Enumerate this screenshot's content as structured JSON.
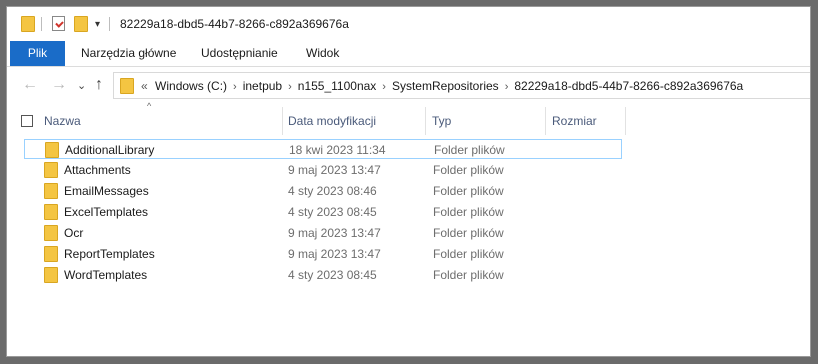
{
  "titlebar": {
    "title": "82229a18-dbd5-44b7-8266-c892a369676a",
    "icons": [
      "folder-icon",
      "properties-check-icon",
      "new-folder-icon",
      "dropdown-icon"
    ]
  },
  "ribbon": {
    "tabs": [
      "Plik",
      "Narzędzia główne",
      "Udostępnianie",
      "Widok"
    ],
    "accent": "#1a6cc8"
  },
  "nav": {
    "back": "←",
    "forward": "→",
    "recent": "⌄",
    "up": "↑",
    "overflow": "«",
    "crumbs": [
      "Windows (C:)",
      "inetpub",
      "n155_1100nax",
      "SystemRepositories",
      "82229a18-dbd5-44b7-8266-c892a369676a"
    ]
  },
  "columns": {
    "name": "Nazwa",
    "date": "Data modyfikacji",
    "type": "Typ",
    "size": "Rozmiar"
  },
  "rows": [
    {
      "name": "AdditionalLibrary",
      "date": "18 kwi 2023 11:34",
      "type": "Folder plików"
    },
    {
      "name": "Attachments",
      "date": "9 maj 2023 13:47",
      "type": "Folder plików"
    },
    {
      "name": "EmailMessages",
      "date": "4 sty 2023 08:46",
      "type": "Folder plików"
    },
    {
      "name": "ExcelTemplates",
      "date": "4 sty 2023 08:45",
      "type": "Folder plików"
    },
    {
      "name": "Ocr",
      "date": "9 maj 2023 13:47",
      "type": "Folder plików"
    },
    {
      "name": "ReportTemplates",
      "date": "9 maj 2023 13:47",
      "type": "Folder plików"
    },
    {
      "name": "WordTemplates",
      "date": "4 sty 2023 08:45",
      "type": "Folder plików"
    }
  ],
  "colors": {
    "folder": "#f4c542",
    "selection_border": "#99d1ff"
  }
}
